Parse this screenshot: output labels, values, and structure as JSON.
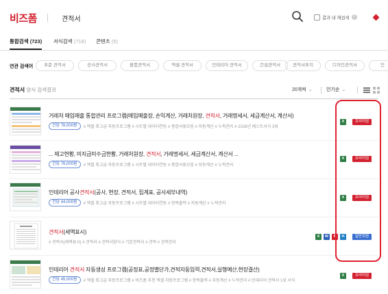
{
  "header": {
    "logo": "비즈폼",
    "search_value": "견적서",
    "in_result_label": "결과 내 재검색"
  },
  "tabs": [
    {
      "label": "통합검색",
      "count": "(723)"
    },
    {
      "label": "서식검색",
      "count": "(718)"
    },
    {
      "label": "콘텐츠",
      "count": "(5)"
    }
  ],
  "related": {
    "label": "연관 검색어",
    "chips": [
      "표준 견적서",
      "공사견적서",
      "물품견적서",
      "엑셀 견적서",
      "인테리어 견적서",
      "건설견적서",
      "견적서표지",
      "디자인견적서",
      "인"
    ]
  },
  "list_header": {
    "title": "견적서",
    "subtitle": "양식 검색결과",
    "per_page": "20개씩",
    "sort": "인기순"
  },
  "items": [
    {
      "title_pre": "거래처 매입매출 통합관리 프로그램(매입매출장, 손익계산, 거래처원장, ",
      "title_hl": "견적서",
      "title_post": ", 거래명세서, 세금계산서, 계산서)",
      "price": "건당 76,000원",
      "tags": "# 엑셀 최고급 자동프로그램  # 시트별 데이터연동  # 종합서류모음  # 자동계산  # 누적관리  # 2026년 베스트서식 3위",
      "formats": [
        "X"
      ],
      "badge": "프리미엄"
    },
    {
      "title_pre": "... 재고현황, 미지급미수금현황, 거래처원장, ",
      "title_hl": "견적서",
      "title_post": ", 거래명세서, 세금계산서, 계산서 ...",
      "price": "건당 76,000원",
      "tags": "# 엑셀 최고급 자동프로그램  # 시트별 데이터연동  # 종합서류모음  # 자동계산  # 누적관리",
      "formats": [
        "X"
      ],
      "badge": "프리미엄"
    },
    {
      "title_pre": "인테리어 공사",
      "title_hl": "견적서",
      "title_post": "(공사, 현장, 견적서, 집계표, 공사세부내역)",
      "price": "건당 44,000원",
      "tags": "# 엑셀 최고급 자동프로그램  # 시트별 데이터연동  # 항목출력  # 자동계산  # 누적관리",
      "formats": [
        "X"
      ],
      "badge": "프리미엄"
    },
    {
      "title_pre": "",
      "title_hl": "견적서",
      "title_post": "(세액표시)",
      "price": "",
      "tags": "# 견적서(세액표시)  # 견적서  # 견적서양식  # 기본견적서  # 견적  # 견적관리",
      "formats": [
        "X",
        "W",
        "P",
        "H"
      ],
      "badge": "일반회원"
    },
    {
      "title_pre": "인테리어 ",
      "title_hl": "견적서",
      "title_post": " 자동생성 프로그램(공정표,공정별단가,견적자동입력,견적서,실행예산,현장결산)",
      "price": "건당 45,000원",
      "tags": "# 엑셀 최고급 자동프로그램  # 비즈폼 추천 엑셀 자동프로그램  # 항목출력  # 자동계산  # 누적관리  # 인테리어 견적서 1위 서식",
      "formats": [
        "X"
      ],
      "badge": "프리미엄"
    }
  ],
  "colors": {
    "brand": "#d3202f",
    "link_blue": "#3a68c8",
    "excel": "#2e7d45",
    "word": "#2b5fb8",
    "annotation": "#e0202f"
  }
}
